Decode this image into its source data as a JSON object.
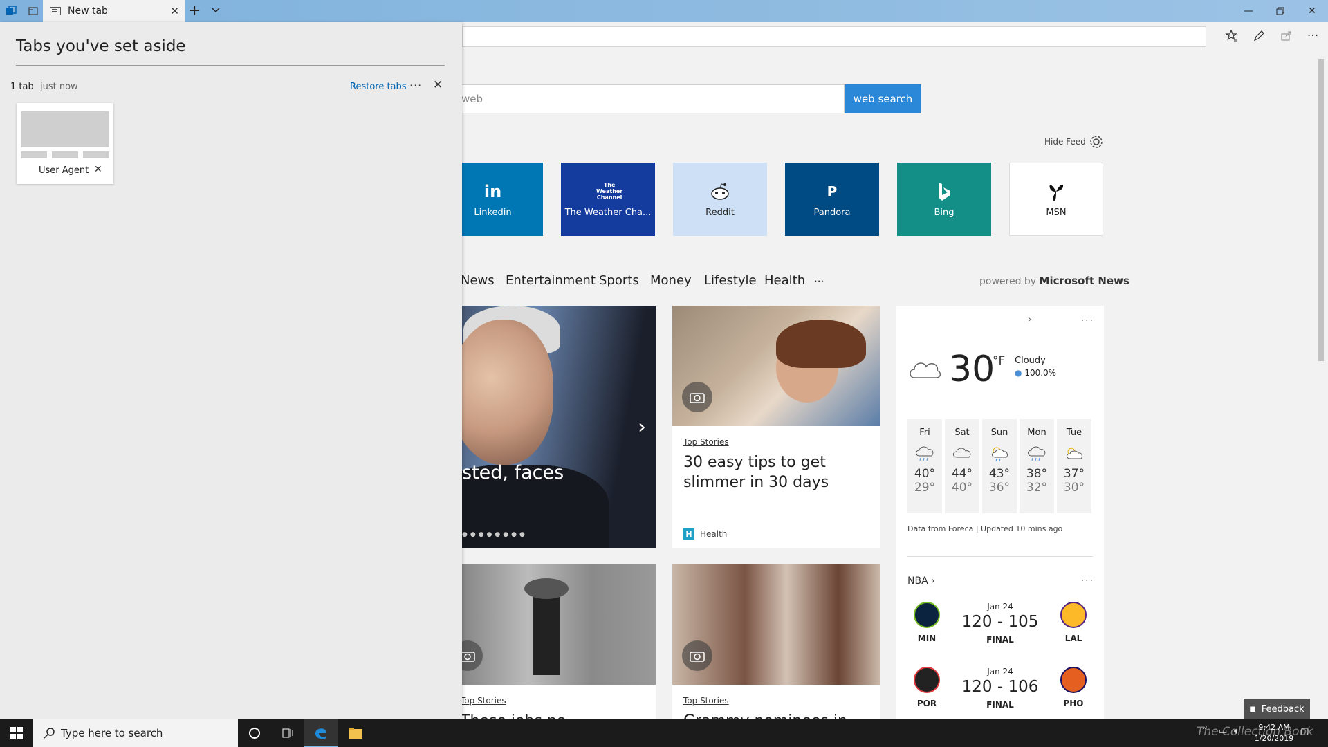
{
  "browser": {
    "tab_title": "New tab",
    "toolbar_icons": [
      "star-list-icon",
      "pen-icon",
      "share-icon",
      "more-icon"
    ]
  },
  "aside": {
    "title": "Tabs you've set aside",
    "count": "1 tab",
    "time": "just now",
    "restore_label": "Restore tabs",
    "more_label": "···",
    "items": [
      {
        "title": "User Agent"
      }
    ]
  },
  "search": {
    "placeholder_visible": "e web",
    "button_label": "web search"
  },
  "feed": {
    "hide_label": "Hide Feed",
    "powered_prefix": "powered by",
    "powered_brand": "Microsoft News"
  },
  "tiles": [
    {
      "label": "Linkedin",
      "logo": "in",
      "color": "#0077b5"
    },
    {
      "label": "The Weather Cha...",
      "logo": "The Weather Channel",
      "color": "#143b9e"
    },
    {
      "label": "Reddit",
      "logo": "reddit",
      "color": "#cde0f5"
    },
    {
      "label": "Pandora",
      "logo": "P",
      "color": "#004b84"
    },
    {
      "label": "Bing",
      "logo": "b",
      "color": "#138f87"
    },
    {
      "label": "MSN",
      "logo": "msn",
      "color": "#ffffff"
    }
  ],
  "categories": [
    "News",
    "Entertainment",
    "Sports",
    "Money",
    "Lifestyle",
    "Health",
    "···"
  ],
  "hero": {
    "headline_fragment": "sted, faces"
  },
  "cards": [
    {
      "category": "Top Stories",
      "headline": "30 easy tips to get slimmer in 30 days",
      "source": "Health"
    },
    {
      "category": "Top Stories",
      "headline": "These jobs no"
    },
    {
      "category": "Top Stories",
      "headline": "Grammy nominees in"
    }
  ],
  "weather": {
    "temp": "30",
    "unit": "°F",
    "condition": "Cloudy",
    "humidity": "100.0%",
    "forecast": [
      {
        "day": "Fri",
        "hi": "40°",
        "lo": "29°",
        "icon": "rain-icon"
      },
      {
        "day": "Sat",
        "hi": "44°",
        "lo": "40°",
        "icon": "cloud-icon"
      },
      {
        "day": "Sun",
        "hi": "43°",
        "lo": "36°",
        "icon": "sun-rain-icon"
      },
      {
        "day": "Mon",
        "hi": "38°",
        "lo": "32°",
        "icon": "rain-icon"
      },
      {
        "day": "Tue",
        "hi": "37°",
        "lo": "30°",
        "icon": "partly-sunny-icon"
      }
    ],
    "data_source": "Data from Foreca | Updated 10 mins ago"
  },
  "nba": {
    "title": "NBA",
    "games": [
      {
        "date": "Jan 24",
        "score": "120 - 105",
        "status": "FINAL",
        "home": "MIN",
        "away": "LAL"
      },
      {
        "date": "Jan 24",
        "score": "120 - 106",
        "status": "FINAL",
        "home": "POR",
        "away": "PHO"
      }
    ]
  },
  "feedback_label": "Feedback",
  "taskbar": {
    "search_placeholder": "Type here to search",
    "time": "9:42 AM",
    "date": "1/20/2019",
    "watermark": "The Collection Book"
  }
}
